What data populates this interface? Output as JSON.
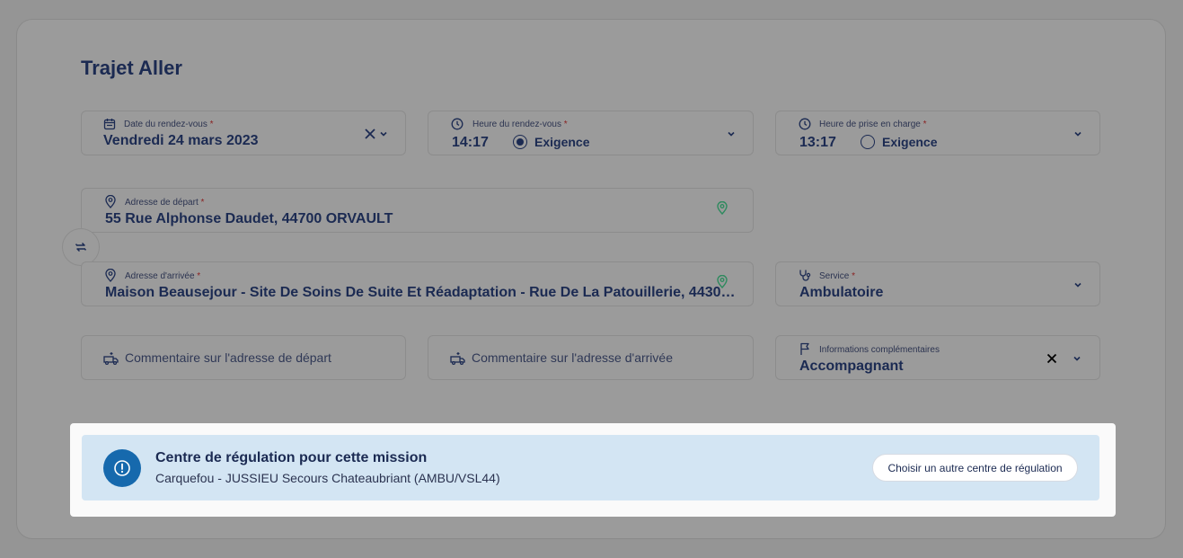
{
  "page": {
    "title": "Trajet Aller"
  },
  "fields": {
    "date": {
      "label": "Date du rendez-vous",
      "required_mark": "*",
      "value": "Vendredi 24 mars 2023",
      "icon": "calendar-icon"
    },
    "heure_rdv": {
      "label": "Heure du rendez-vous",
      "required_mark": "*",
      "value": "14:17",
      "exigence_label": "Exigence",
      "exigence_checked": true,
      "icon": "clock-icon"
    },
    "heure_prise": {
      "label": "Heure de prise en charge",
      "required_mark": "*",
      "value": "13:17",
      "exigence_label": "Exigence",
      "exigence_checked": false,
      "icon": "clock-icon"
    },
    "depart": {
      "label": "Adresse de départ",
      "required_mark": "*",
      "value": "55 Rue Alphonse Daudet, 44700 ORVAULT",
      "icon": "map-pin-icon"
    },
    "arrivee": {
      "label": "Adresse d'arrivée",
      "required_mark": "*",
      "value": "Maison Beausejour - Site De Soins De Suite Et Réadaptation - Rue De La Patouillerie, 4430…",
      "icon": "map-pin-icon"
    },
    "service": {
      "label": "Service",
      "required_mark": "*",
      "value": "Ambulatoire",
      "icon": "stethoscope-icon"
    },
    "comment_depart": {
      "placeholder": "Commentaire sur l'adresse de départ",
      "icon": "truck-icon"
    },
    "comment_arrivee": {
      "placeholder": "Commentaire sur l'adresse d'arrivée",
      "icon": "truck-icon"
    },
    "infos": {
      "label": "Informations complémentaires",
      "value": "Accompagnant",
      "icon": "flag-icon"
    }
  },
  "banner": {
    "title": "Centre de régulation pour cette mission",
    "subtitle": "Carquefou - JUSSIEU Secours Chateaubriant (AMBU/VSL44)",
    "button_label": "Choisir un autre centre de régulation"
  },
  "colors": {
    "overlay": "#959595",
    "text_primary": "#1b2a52",
    "banner_bg": "#d3e5f3",
    "accent": "#1669ad",
    "pin_green": "#2e8a5e",
    "required": "#8a1f1f"
  }
}
